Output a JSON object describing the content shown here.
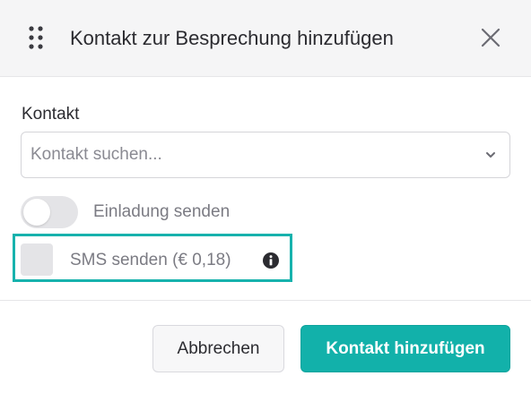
{
  "dialog": {
    "title": "Kontakt zur Besprechung hinzufügen",
    "drag_icon": "drag-handle-icon",
    "close_icon": "close-icon"
  },
  "contact_field": {
    "label": "Kontakt",
    "placeholder": "Kontakt suchen...",
    "chevron_icon": "chevron-down-icon"
  },
  "invitation_toggle": {
    "label": "Einladung senden",
    "checked": false
  },
  "sms_option": {
    "label": "SMS senden (€ 0,18)",
    "checked": false,
    "info_icon": "info-icon",
    "highlight_color": "#17b2ad"
  },
  "footer": {
    "cancel_label": "Abbrechen",
    "submit_label": "Kontakt hinzufügen"
  },
  "colors": {
    "accent": "#12b1aa",
    "header_bg": "#f5f5f6",
    "text": "#2b2b30",
    "muted_text": "#7b7b83"
  }
}
